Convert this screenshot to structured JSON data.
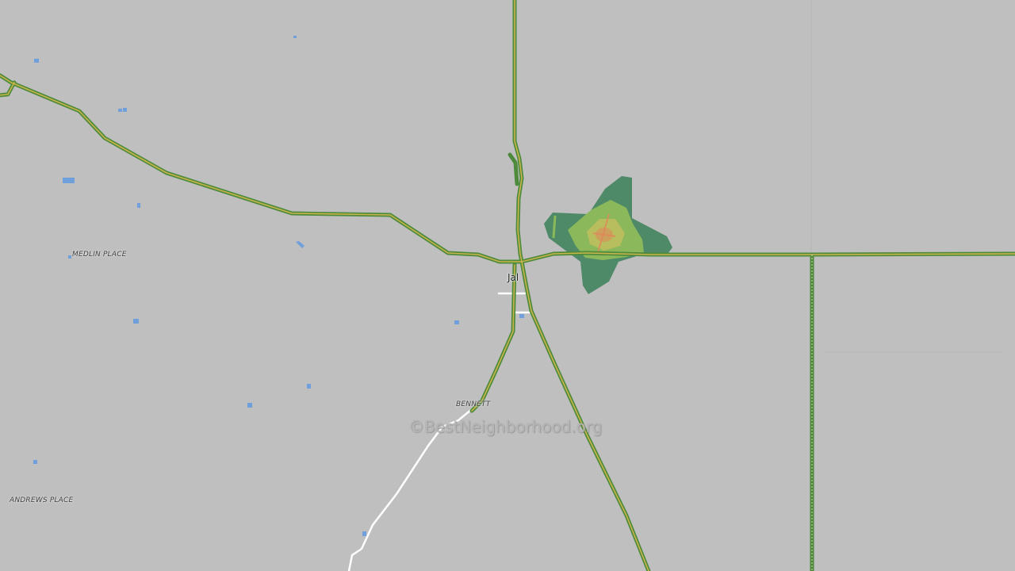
{
  "map": {
    "colors": {
      "background": "#bfbfbf",
      "road_outer": "#4e8a3c",
      "road_inner": "#c8b44a",
      "local_road": "#ffffff",
      "water": "#6fa0dc",
      "heat_outer": "#4f8a68",
      "heat_mid": "#8ab85a",
      "heat_inner": "#c8c060",
      "heat_core": "#e08a5a"
    },
    "places": [
      {
        "name": "MEDLIN PLACE"
      },
      {
        "name": "BENNETT"
      },
      {
        "name": "ANDREWS PLACE"
      }
    ],
    "city": {
      "name": "Jal"
    },
    "watermark": "©BestNeighborhood.org"
  }
}
